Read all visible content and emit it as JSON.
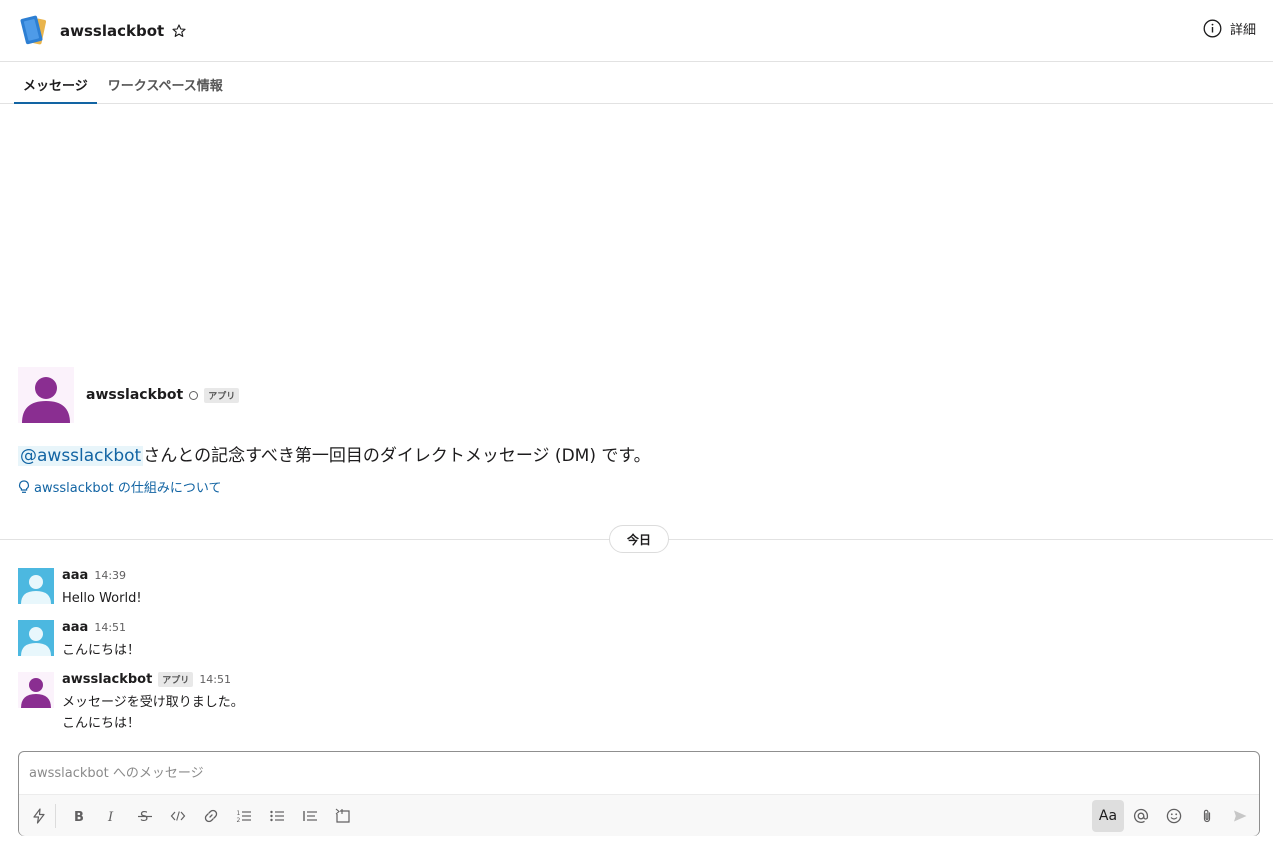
{
  "header": {
    "title": "awsslackbot",
    "details_label": "詳細"
  },
  "tabs": [
    {
      "label": "メッセージ",
      "active": true
    },
    {
      "label": "ワークスペース情報",
      "active": false
    }
  ],
  "intro": {
    "name": "awsslackbot",
    "badge": "アプリ",
    "mention": "@awsslackbot",
    "text": "さんとの記念すべき第一回目のダイレクトメッセージ (DM) です。",
    "link": "awsslackbot の仕組みについて"
  },
  "day_divider": "今日",
  "messages": [
    {
      "author": "aaa",
      "time": "14:39",
      "lines": [
        "Hello World!"
      ]
    },
    {
      "author": "aaa",
      "time": "14:51",
      "lines": [
        "こんにちは！"
      ]
    },
    {
      "author": "awsslackbot",
      "badge": "アプリ",
      "time": "14:51",
      "lines": [
        "メッセージを受け取りました。",
        "こんにちは！"
      ]
    }
  ],
  "composer": {
    "placeholder": "awsslackbot へのメッセージ",
    "format_label": "Aa"
  },
  "colors": {
    "accent": "#1264a3",
    "bot_avatar": "#8a2e91",
    "user_avatar": "#4cb8e0"
  }
}
